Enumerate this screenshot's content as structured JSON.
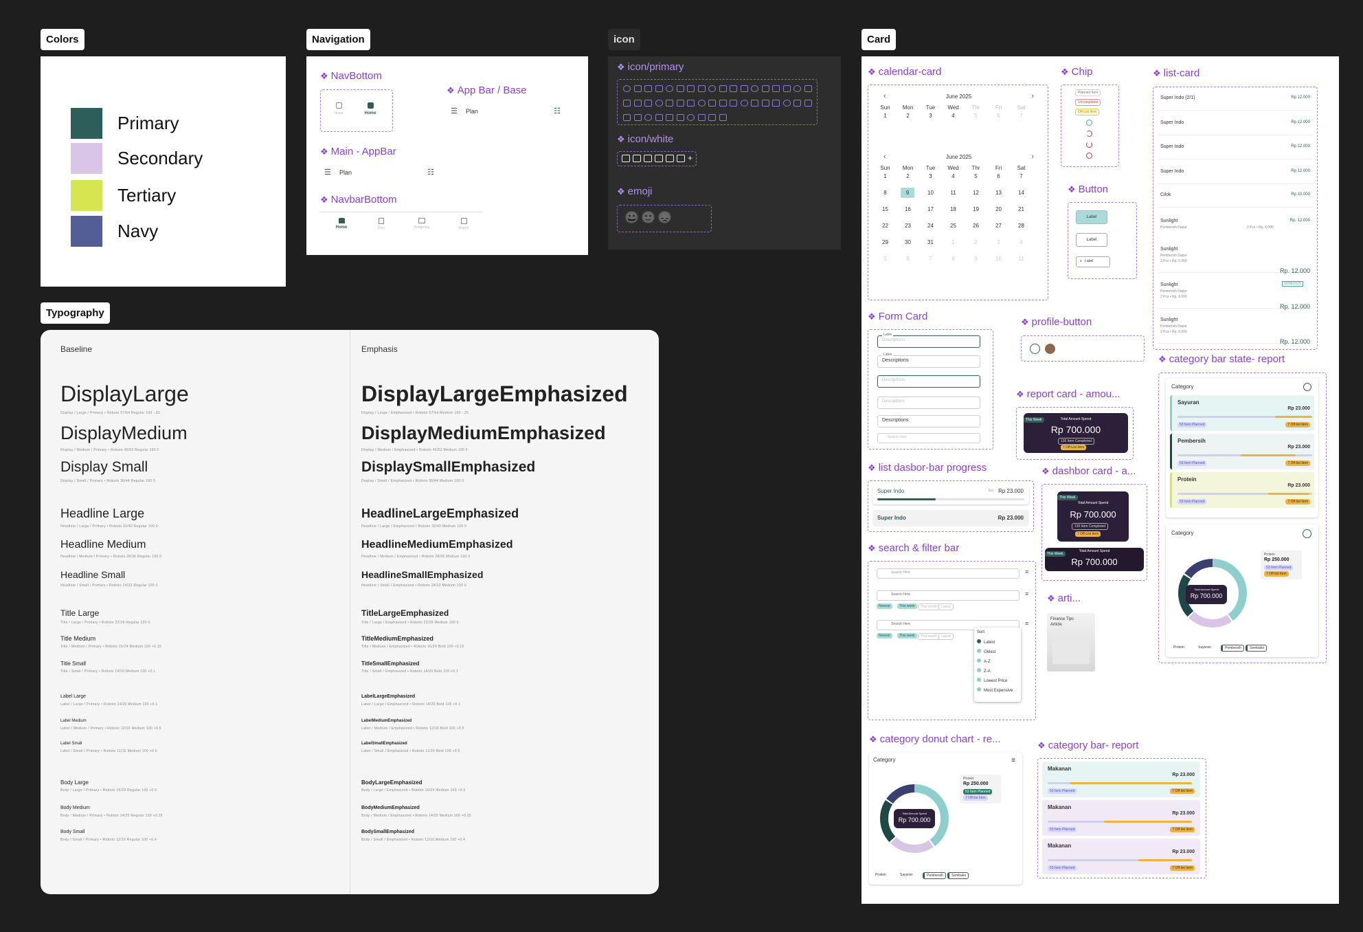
{
  "sections": {
    "colors": "Colors",
    "navigation": "Navigation",
    "icon": "icon",
    "card": "Card",
    "typography": "Typography"
  },
  "colors": [
    {
      "name": "Primary",
      "hex": "#2e5e5a"
    },
    {
      "name": "Secondary",
      "hex": "#d9c6e6"
    },
    {
      "name": "Tertiary",
      "hex": "#d6e650"
    },
    {
      "name": "Navy",
      "hex": "#535d96"
    }
  ],
  "navigation": {
    "navbottom": "NavBottom",
    "nav_items": [
      "Home",
      "Home"
    ],
    "appbar_base": "App Bar / Base",
    "plan": "Plan",
    "main_appbar": "Main - AppBar",
    "navbar_bottom": "NavbarBottom",
    "navbar_items": [
      "Home",
      "Plan",
      "Budgeting",
      "Report"
    ]
  },
  "icons": {
    "primary": "icon/primary",
    "white": "icon/white",
    "emoji": "emoji",
    "emojis": [
      "😀",
      "🙂",
      "😞"
    ]
  },
  "typography": {
    "baseline_head": "Baseline",
    "emphasis_head": "Emphasis",
    "baseline": [
      {
        "n": "DisplayLarge",
        "m": "Display / Large / Primary  •  Roboto  57/64  Regular  100  -.25"
      },
      {
        "n": "DisplayMedium",
        "m": "Display / Medium / Primary  •  Roboto  45/52  Regular  100  0"
      },
      {
        "n": "Display Small",
        "m": "Display / Small / Primary  •  Roboto  36/44  Regular  100  0"
      },
      {
        "n": "Headline Large",
        "m": "Headline / Large / Primary  •  Roboto  32/40  Regular  100  0"
      },
      {
        "n": "Headline Medium",
        "m": "Headline / Medium / Primary  •  Roboto  28/36  Regular  100  0"
      },
      {
        "n": "Headline Small",
        "m": "Headline / Small / Primary  •  Roboto  24/32  Regular  100  0"
      },
      {
        "n": "Title Large",
        "m": "Title / Large / Primary  •  Roboto  22/28  Regular  100  0"
      },
      {
        "n": "Title Medium",
        "m": "Title / Medium / Primary  •  Roboto  16/24  Medium  100  +0.15"
      },
      {
        "n": "Title Small",
        "m": "Title / Small / Primary  •  Roboto  14/20  Medium  100  +0.1"
      },
      {
        "n": "Label Large",
        "m": "Label / Large / Primary  •  Roboto  14/20  Medium  100  +0.1"
      },
      {
        "n": "Label Medium",
        "m": "Label / Medium / Primary  •  Roboto  12/16  Medium  100  +0.5"
      },
      {
        "n": "Label Small",
        "m": "Label / Small / Primary  •  Roboto  11/16  Medium  100  +0.5"
      },
      {
        "n": "Body Large",
        "m": "Body / Large / Primary  •  Roboto  16/24  Regular  100  +0.5"
      },
      {
        "n": "Body Medium",
        "m": "Body / Medium / Primary  •  Roboto  14/20  Regular  100  +0.25"
      },
      {
        "n": "Body Small",
        "m": "Body / Small / Primary  •  Roboto  12/16  Regular  100  +0.4"
      }
    ],
    "emphasis": [
      {
        "n": "DisplayLargeEmphasized",
        "m": "Display / Large / Emphasized  •  Roboto  57/64  Medium  100  -.25"
      },
      {
        "n": "DisplayMediumEmphasized",
        "m": "Display / Medium / Emphasized  •  Roboto  45/52  Medium  100  0"
      },
      {
        "n": "DisplaySmallEmphasized",
        "m": "Display / Small / Emphasized  •  Roboto  36/44  Medium  100  0"
      },
      {
        "n": "HeadlineLargeEmphasized",
        "m": "Headline / Large / Emphasized  •  Roboto  32/40  Medium  100  0"
      },
      {
        "n": "HeadlineMediumEmphasized",
        "m": "Headline / Medium / Emphasized  •  Roboto  28/36  Medium  100  0"
      },
      {
        "n": "HeadlineSmallEmphasized",
        "m": "Headline / Small / Emphasized  •  Roboto  24/32  Medium  100  0"
      },
      {
        "n": "TitleLargeEmphasized",
        "m": "Title / Large / Emphasized  •  Roboto  22/28  Medium  100  0"
      },
      {
        "n": "TitleMediumEmphasized",
        "m": "Title / Medium / Emphasized  •  Roboto  16/24  Bold  100  +0.15"
      },
      {
        "n": "TitleSmallEmphasized",
        "m": "Title / Small / Emphasized  •  Roboto  14/20  Bold  100  +0.1"
      },
      {
        "n": "LabelLargeEmphasized",
        "m": "Label / Large / Emphasized  •  Roboto  14/20  Bold  100  +0.1"
      },
      {
        "n": "LabelMediumEmphasized",
        "m": "Label / Medium / Emphasized  •  Roboto  12/16  Bold  100  +0.5"
      },
      {
        "n": "LabelSmallEmphasized",
        "m": "Label / Small / Emphasized  •  Roboto  11/16  Bold  100  +0.5"
      },
      {
        "n": "BodyLargeEmphasized",
        "m": "Body / Large / Emphasized  •  Roboto  16/24  Medium  100  +0.5"
      },
      {
        "n": "BodyMediumEmphasized",
        "m": "Body / Medium / Emphasized  •  Roboto  14/20  Medium  100  +0.25"
      },
      {
        "n": "BodySmallEmphasized",
        "m": "Body / Small / Emphasized  •  Roboto  12/16  Medium  100  +0.4"
      }
    ]
  },
  "cards": {
    "calendar_card": "calendar-card",
    "chip": "Chip",
    "list_card": "list-card",
    "button": "Button",
    "form_card": "Form Card",
    "profile_button": "profile-button",
    "report_card": "report card - amou...",
    "list_dasbor": "list dasbor-bar progress",
    "dashbor_card": "dashbor card - a...",
    "search_filter": "search & filter bar",
    "arti": "arti...",
    "cat_state": "category bar state- report",
    "cat_donut": "category donut chart - re...",
    "cat_bar": "category bar- report",
    "month": "June 2025",
    "weekdays": [
      "Sun",
      "Mon",
      "Tue",
      "Wed",
      "Thr",
      "Fri",
      "Sat"
    ],
    "chips": [
      "Planned Item",
      "Uncompleted",
      "Off-List Item"
    ],
    "btn_label": "Label",
    "form_lable": "Lable",
    "form_desc": "Descriptions",
    "search_here": "Search Here",
    "total_amount": "Total Amount Spend",
    "this_week": "This Week",
    "amount": "Rp 700.000",
    "items_completed": "130 Item Completed",
    "off_list": "7 Off-List Item",
    "super_indo": "Super Indo",
    "est": "Est",
    "rp23": "Rp 23.000",
    "rp12": "Rp 12.000",
    "rp10": "Rp 10.000",
    "list_names": [
      "Super Indo (2/1)",
      "Super Indo",
      "Super Indo",
      "Super Indo",
      "Cilok",
      "Sunlight",
      "Sunlight",
      "Sunlight",
      "Sunlight"
    ],
    "pembersih_dapur": "Pembersih Dapur",
    "sunlight_sub": "2 Pcs  •  Rp. 6.000",
    "rp_12k": "Rp. 12.000",
    "date_chip": "02/06/2025",
    "sort": "Sort",
    "sort_opts": [
      "Latest",
      "Oldest",
      "A-Z",
      "Z-A",
      "Lowest Price",
      "Most Expensive"
    ],
    "filter_chips": [
      "Newest",
      "This week",
      "This month",
      "Latest"
    ],
    "article": "Finance Tips Article",
    "category": "Category",
    "cat_items": [
      "Sayuran",
      "Pembersih",
      "Protein"
    ],
    "item_planned": "53 Item Planned",
    "off_item": "7 Off-list Item",
    "protein": "Protein",
    "rp250": "Rp 250.000",
    "legend": [
      "Protein",
      "Sayuran",
      "Pembersih",
      "Sembako"
    ],
    "makanan": "Makanan"
  }
}
